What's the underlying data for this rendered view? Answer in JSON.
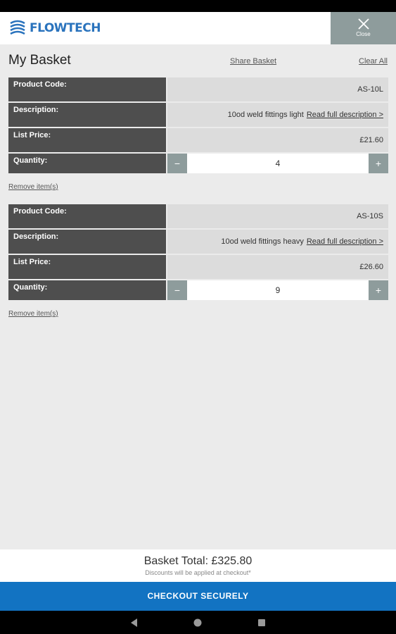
{
  "header": {
    "brand": "FLOWTECH",
    "close_label": "Close"
  },
  "basket": {
    "title": "My Basket",
    "share_label": "Share Basket",
    "clear_label": "Clear All"
  },
  "labels": {
    "product_code": "Product Code:",
    "description": "Description:",
    "list_price": "List Price:",
    "quantity": "Quantity:",
    "read_more": "Read full description >",
    "remove": "Remove item(s)",
    "minus": "−",
    "plus": "+"
  },
  "items": [
    {
      "product_code": "AS-10L",
      "description": "10od weld fittings light",
      "list_price": "£21.60",
      "quantity": "4"
    },
    {
      "product_code": "AS-10S",
      "description": "10od weld fittings heavy",
      "list_price": "£26.60",
      "quantity": "9"
    }
  ],
  "footer": {
    "total": "Basket Total: £325.80",
    "discount_note": "Discounts will be applied at checkout*",
    "checkout_label": "CHECKOUT SECURELY"
  },
  "colors": {
    "brand_blue": "#2a73bd",
    "checkout_blue": "#1273c2",
    "label_dark": "#4e4e4e",
    "button_grey": "#8e9c9c"
  }
}
